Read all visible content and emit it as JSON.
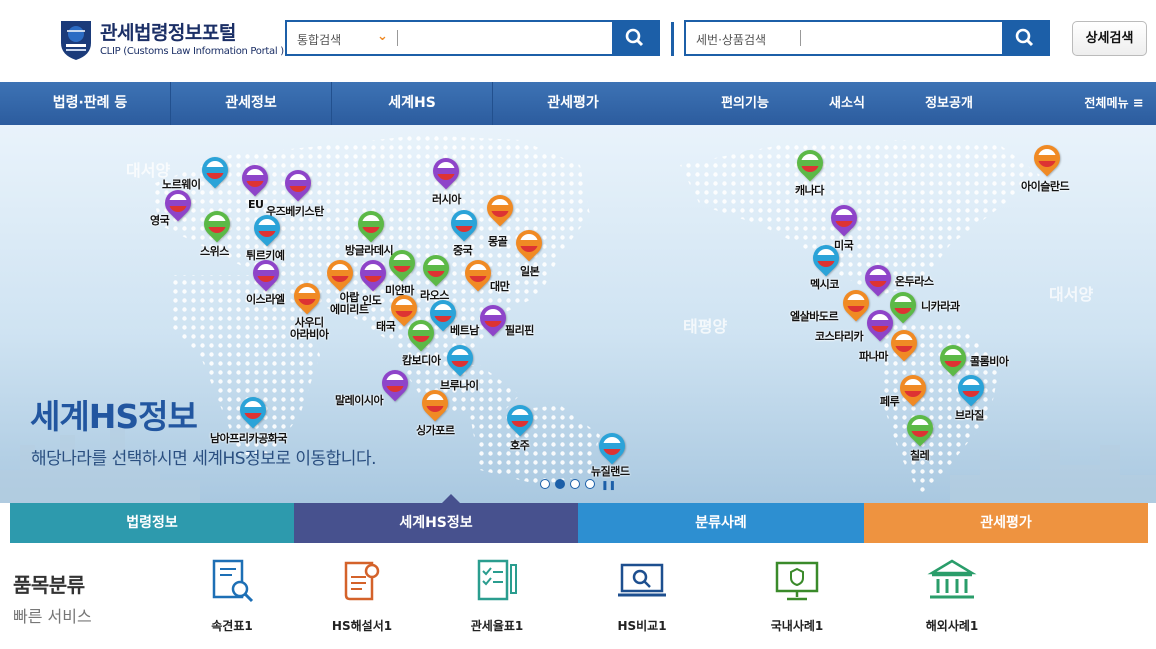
{
  "header": {
    "logo_title": "관세법령정보포털",
    "logo_subtitle": "CLIP (Customs Law Information Portal )",
    "search1_scope": "통합검색",
    "search2_scope": "세번·상품검색",
    "advanced_search": "상세검색"
  },
  "nav": {
    "items": [
      "법령·판례 등",
      "관세정보",
      "세계HS",
      "관세평가",
      "편의기능",
      "새소식",
      "정보공개"
    ],
    "full_menu": "전체메뉴"
  },
  "hero": {
    "title": "세계HS정보",
    "subtitle": "해당나라를 선택하시면 세계HS정보로 이동합니다.",
    "oceans": [
      "대서양",
      "태평양",
      "대서양"
    ],
    "countries": [
      {
        "name": "노르웨이",
        "color": "#2ba3d8"
      },
      {
        "name": "EU",
        "color": "#8e44c9"
      },
      {
        "name": "우즈베키스탄",
        "color": "#8e44c9"
      },
      {
        "name": "영국",
        "color": "#8e44c9"
      },
      {
        "name": "스위스",
        "color": "#5cb947"
      },
      {
        "name": "튀르키예",
        "color": "#2ba3d8"
      },
      {
        "name": "이스라엘",
        "color": "#8e44c9"
      },
      {
        "name": "방글라데시",
        "color": "#5cb947"
      },
      {
        "name": "사우디 아라비아",
        "color": "#f08a24"
      },
      {
        "name": "아랍 에미리트",
        "color": "#f08a24"
      },
      {
        "name": "인도",
        "color": "#8e44c9"
      },
      {
        "name": "미얀마",
        "color": "#5cb947"
      },
      {
        "name": "라오스",
        "color": "#5cb947"
      },
      {
        "name": "러시아",
        "color": "#8e44c9"
      },
      {
        "name": "중국",
        "color": "#2ba3d8"
      },
      {
        "name": "몽골",
        "color": "#f08a24"
      },
      {
        "name": "일본",
        "color": "#f08a24"
      },
      {
        "name": "대만",
        "color": "#f08a24"
      },
      {
        "name": "태국",
        "color": "#f08a24"
      },
      {
        "name": "캄보디아",
        "color": "#5cb947"
      },
      {
        "name": "베트남",
        "color": "#2ba3d8"
      },
      {
        "name": "필리핀",
        "color": "#8e44c9"
      },
      {
        "name": "브루나이",
        "color": "#2ba3d8"
      },
      {
        "name": "말레이시아",
        "color": "#8e44c9"
      },
      {
        "name": "싱가포르",
        "color": "#f08a24"
      },
      {
        "name": "남아프리카공화국",
        "color": "#2ba3d8"
      },
      {
        "name": "호주",
        "color": "#2ba3d8"
      },
      {
        "name": "뉴질랜드",
        "color": "#2ba3d8"
      },
      {
        "name": "캐나다",
        "color": "#5cb947"
      },
      {
        "name": "미국",
        "color": "#8e44c9"
      },
      {
        "name": "멕시코",
        "color": "#2ba3d8"
      },
      {
        "name": "온두라스",
        "color": "#8e44c9"
      },
      {
        "name": "엘살바도르",
        "color": "#f08a24"
      },
      {
        "name": "니카라과",
        "color": "#5cb947"
      },
      {
        "name": "코스타리카",
        "color": "#8e44c9"
      },
      {
        "name": "파나마",
        "color": "#f08a24"
      },
      {
        "name": "콜롬비아",
        "color": "#5cb947"
      },
      {
        "name": "페루",
        "color": "#f08a24"
      },
      {
        "name": "브라질",
        "color": "#2ba3d8"
      },
      {
        "name": "칠레",
        "color": "#5cb947"
      },
      {
        "name": "아이슬란드",
        "color": "#f08a24"
      }
    ]
  },
  "tabs": [
    {
      "label": "법령정보",
      "color": "#2d9aad"
    },
    {
      "label": "세계HS정보",
      "color": "#47518e"
    },
    {
      "label": "분류사례",
      "color": "#2d8fd1"
    },
    {
      "label": "관세평가",
      "color": "#ee9340"
    }
  ],
  "quick": {
    "title": "품목분류",
    "subtitle": "빠른 서비스",
    "items": [
      {
        "label": "속견표1",
        "icon": "document-search-icon"
      },
      {
        "label": "HS해설서1",
        "icon": "scroll-certificate-icon"
      },
      {
        "label": "관세율표1",
        "icon": "checklist-clipboard-icon"
      },
      {
        "label": "HS비교1",
        "icon": "laptop-search-icon"
      },
      {
        "label": "국내사례1",
        "icon": "monitor-shield-icon"
      },
      {
        "label": "해외사례1",
        "icon": "bank-building-icon"
      }
    ]
  }
}
